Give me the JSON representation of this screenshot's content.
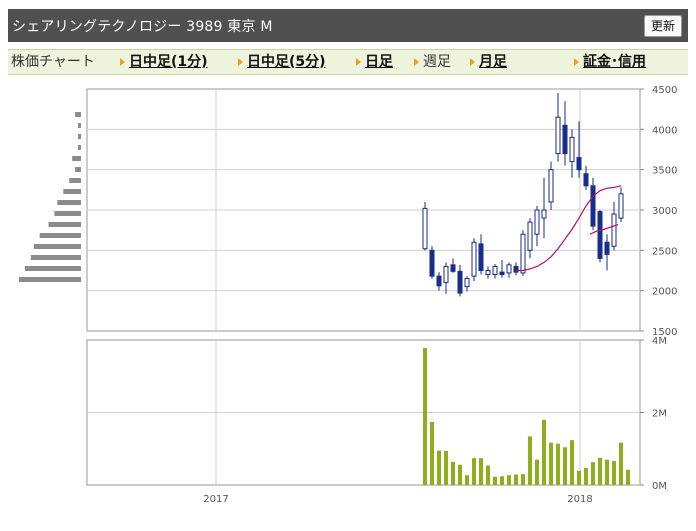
{
  "header": {
    "title": "シェアリングテクノロジー 3989 東京 M",
    "refresh_label": "更新"
  },
  "nav": {
    "label": "株価チャート",
    "items": [
      {
        "label": "日中足(1分)",
        "link": true
      },
      {
        "label": "日中足(5分)",
        "link": true
      },
      {
        "label": "日足",
        "link": true
      },
      {
        "label": "週足",
        "link": false
      },
      {
        "label": "月足",
        "link": true
      }
    ],
    "margin_link": "証金･信用"
  },
  "chart_data": [
    {
      "type": "candlestick",
      "x_ticks": [
        "2017",
        "2018"
      ],
      "y_ticks": [
        1500,
        2000,
        2500,
        3000,
        3500,
        4000,
        4500
      ],
      "ylim": [
        1500,
        4500
      ],
      "grid": true,
      "candles": [
        {
          "o": 2520,
          "h": 3100,
          "l": 2500,
          "c": 3020
        },
        {
          "o": 2500,
          "h": 2550,
          "l": 2150,
          "c": 2180
        },
        {
          "o": 2180,
          "h": 2230,
          "l": 2000,
          "c": 2060
        },
        {
          "o": 2100,
          "h": 2350,
          "l": 1960,
          "c": 2300
        },
        {
          "o": 2320,
          "h": 2400,
          "l": 2220,
          "c": 2240
        },
        {
          "o": 2240,
          "h": 2320,
          "l": 1930,
          "c": 1970
        },
        {
          "o": 2050,
          "h": 2180,
          "l": 1990,
          "c": 2150
        },
        {
          "o": 2180,
          "h": 2650,
          "l": 2120,
          "c": 2600
        },
        {
          "o": 2580,
          "h": 2700,
          "l": 2200,
          "c": 2250
        },
        {
          "o": 2200,
          "h": 2300,
          "l": 2150,
          "c": 2250
        },
        {
          "o": 2200,
          "h": 2330,
          "l": 2150,
          "c": 2300
        },
        {
          "o": 2230,
          "h": 2380,
          "l": 2160,
          "c": 2200
        },
        {
          "o": 2220,
          "h": 2350,
          "l": 2160,
          "c": 2320
        },
        {
          "o": 2300,
          "h": 2350,
          "l": 2190,
          "c": 2230
        },
        {
          "o": 2220,
          "h": 2750,
          "l": 2180,
          "c": 2700
        },
        {
          "o": 2500,
          "h": 2900,
          "l": 2400,
          "c": 2850
        },
        {
          "o": 2700,
          "h": 3050,
          "l": 2550,
          "c": 3000
        },
        {
          "o": 2900,
          "h": 3400,
          "l": 2650,
          "c": 3000
        },
        {
          "o": 3100,
          "h": 3600,
          "l": 3000,
          "c": 3500
        },
        {
          "o": 3700,
          "h": 4450,
          "l": 3600,
          "c": 4150
        },
        {
          "o": 4050,
          "h": 4350,
          "l": 3550,
          "c": 3700
        },
        {
          "o": 3600,
          "h": 4000,
          "l": 3400,
          "c": 3900
        },
        {
          "o": 3650,
          "h": 4100,
          "l": 3400,
          "c": 3500
        },
        {
          "o": 3450,
          "h": 3550,
          "l": 3250,
          "c": 3300
        },
        {
          "o": 3300,
          "h": 3400,
          "l": 2750,
          "c": 2800
        },
        {
          "o": 2980,
          "h": 3000,
          "l": 2350,
          "c": 2400
        },
        {
          "o": 2600,
          "h": 2700,
          "l": 2250,
          "c": 2450
        },
        {
          "o": 2550,
          "h": 3100,
          "l": 2500,
          "c": 2950
        },
        {
          "o": 2900,
          "h": 3280,
          "l": 2850,
          "c": 3200
        }
      ],
      "moving_average_long": [
        2250,
        2250,
        2270,
        2300,
        2350,
        2420,
        2520,
        2640,
        2760,
        2900,
        3050,
        3170,
        3240,
        3270,
        3280,
        3300
      ],
      "moving_average_short": [
        2700,
        2740,
        2760,
        2790,
        2820
      ],
      "volume_profile": [
        2,
        1,
        1,
        1,
        3,
        2,
        4,
        6,
        8,
        9,
        11,
        14,
        16,
        17,
        19,
        21
      ]
    },
    {
      "type": "bar",
      "x_ticks": [
        "2017",
        "2018"
      ],
      "y_ticks": [
        "4M",
        "2M",
        "0M"
      ],
      "ylim": [
        0,
        4000000
      ],
      "grid": true,
      "values": [
        3780000,
        1740000,
        950000,
        940000,
        640000,
        560000,
        270000,
        740000,
        740000,
        540000,
        230000,
        240000,
        270000,
        290000,
        300000,
        1340000,
        700000,
        1800000,
        1170000,
        1140000,
        1040000,
        1240000,
        390000,
        470000,
        630000,
        750000,
        700000,
        660000,
        1170000,
        420000
      ]
    }
  ]
}
